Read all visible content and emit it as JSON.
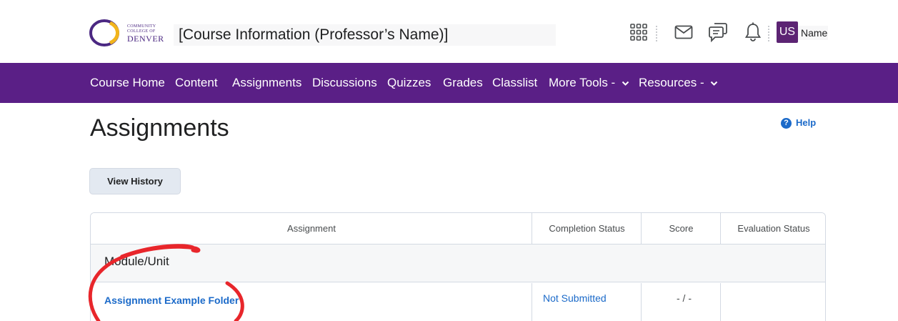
{
  "header": {
    "logo": {
      "line1": "COMMUNITY",
      "line2": "COLLEGE OF",
      "line3": "DENVER"
    },
    "course_title": "[Course Information (Professor’s Name)]",
    "icons": [
      "waffle-grid-icon",
      "mail-icon",
      "chat-icon",
      "bell-icon"
    ],
    "user": {
      "initials": "US",
      "name": "Name"
    },
    "colors": {
      "avatar": "#5c2473"
    }
  },
  "nav": {
    "color": "#5a1f86",
    "items": [
      "Course Home",
      "Content",
      "Assignments",
      "Discussions",
      "Quizzes",
      "Grades",
      "Classlist",
      "More Tools -",
      "Resources -"
    ]
  },
  "page": {
    "title": "Assignments",
    "help_label": "Help",
    "view_history_label": "View History"
  },
  "table": {
    "headers": [
      "Assignment",
      "Completion Status",
      "Score",
      "Evaluation Status"
    ],
    "module": "Module/Unit",
    "rows": [
      {
        "assignment": "Assignment Example Folder",
        "completion": "Not Submitted",
        "score": "- / -",
        "evaluation": ""
      }
    ]
  },
  "annotation": {
    "color": "#e8262b",
    "shape": "hand-drawn circle around module and assignment link"
  }
}
